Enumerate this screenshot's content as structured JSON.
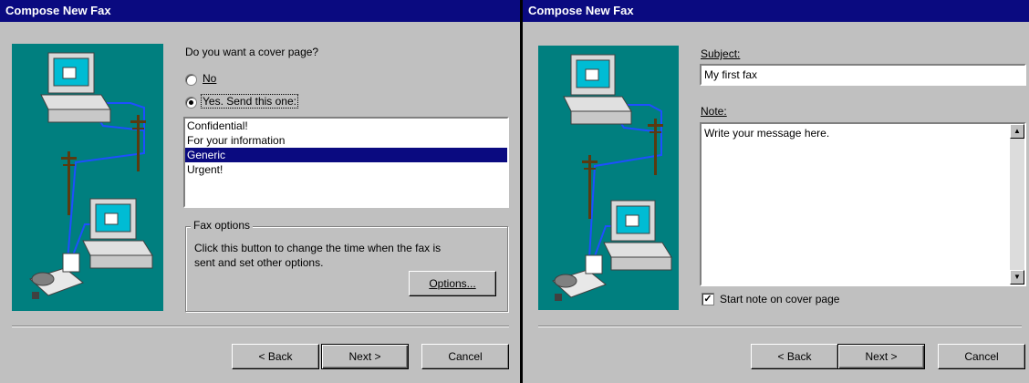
{
  "dialog1": {
    "title": "Compose New Fax",
    "question": "Do you want a cover page?",
    "radio_no": "No",
    "radio_yes": "Yes.  Send this one:",
    "cover_pages": [
      "Confidential!",
      "For your information",
      "Generic",
      "Urgent!"
    ],
    "selected_cover_page": "Generic",
    "fax_options": {
      "group_label": "Fax options",
      "description_line1": "Click this button to change the time when the fax is",
      "description_line2": "sent and set other options.",
      "button": "Options..."
    },
    "buttons": {
      "back": "< Back",
      "next": "Next >",
      "cancel": "Cancel"
    }
  },
  "dialog2": {
    "title": "Compose New Fax",
    "subject_label": "Subject:",
    "subject_value": "My first fax",
    "note_label": "Note:",
    "note_value": "Write your message here.",
    "checkbox_label": "Start note on cover page",
    "checkbox_checked": true,
    "buttons": {
      "back": "< Back",
      "next": "Next >",
      "cancel": "Cancel"
    }
  },
  "colors": {
    "titlebar": "#0a0a80",
    "dialog_face": "#c0c0c0",
    "illustration_bg": "#007f7f",
    "selection": "#0a0a80"
  },
  "icons": [
    "computer-icon",
    "fax-machine-icon",
    "telephone-pole-icon",
    "scroll-up-arrow-icon",
    "scroll-down-arrow-icon"
  ]
}
